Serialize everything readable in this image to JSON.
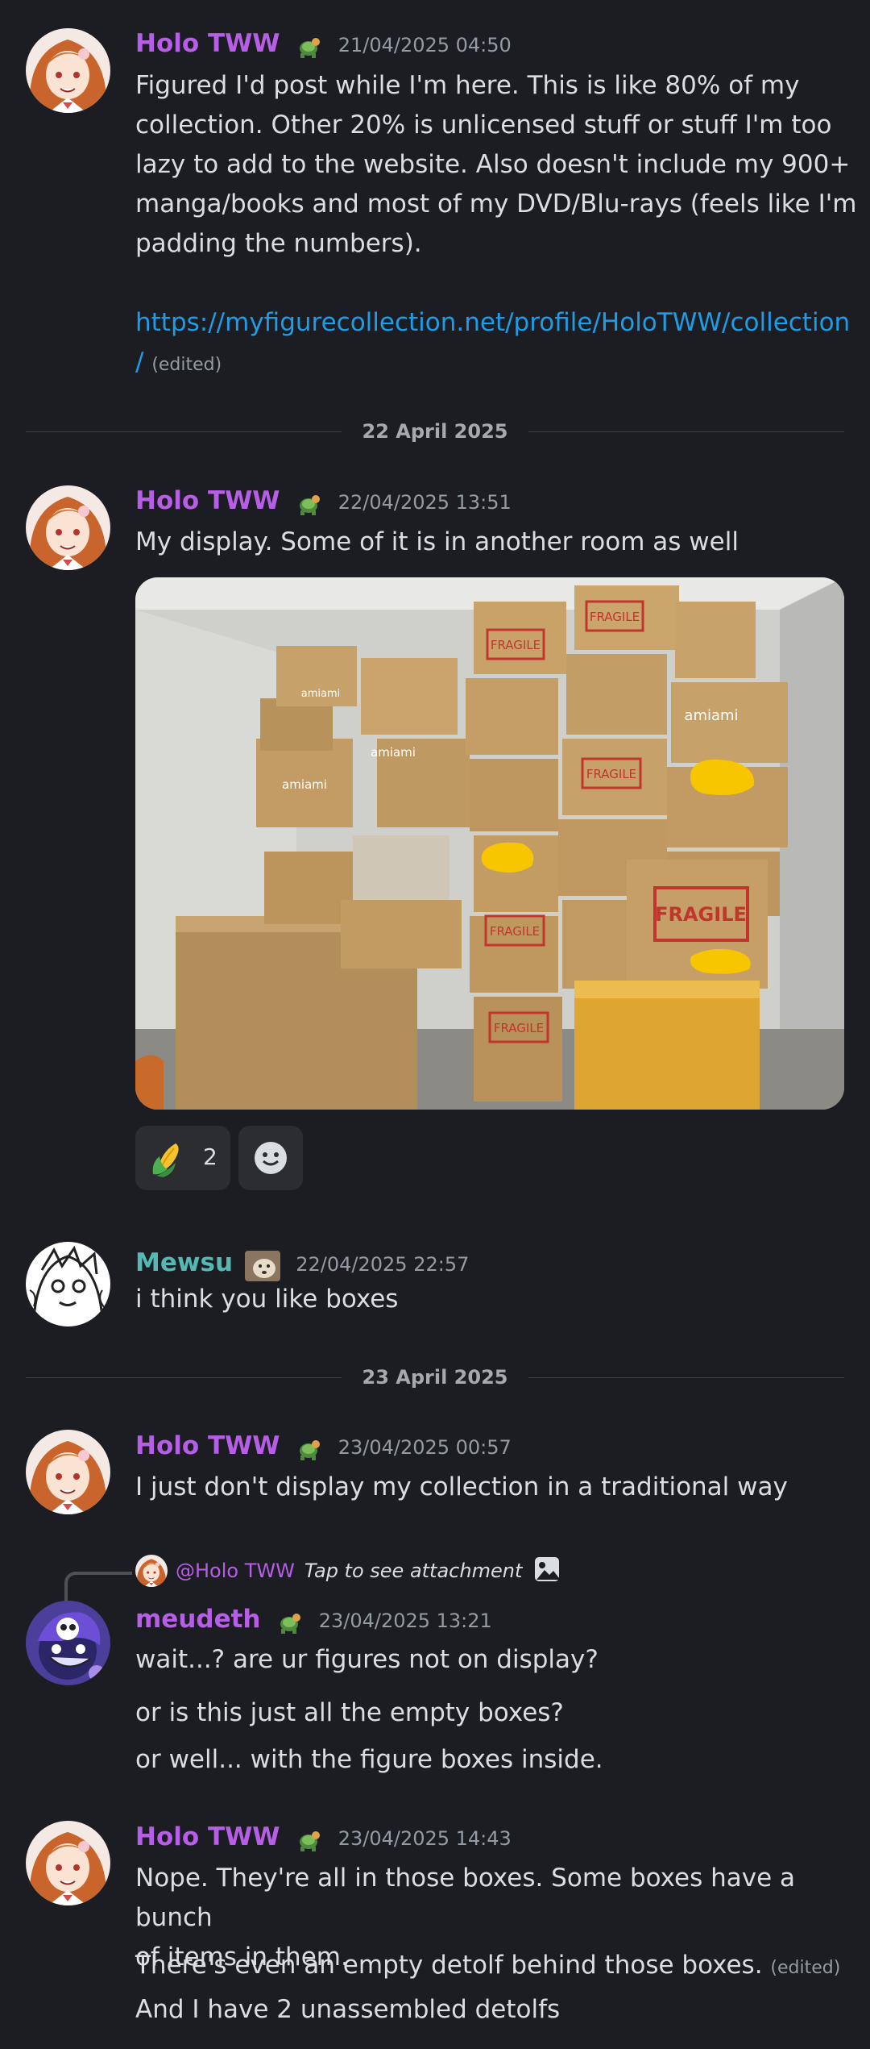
{
  "messages": [
    {
      "author": "Holo TWW",
      "timestamp": "21/04/2025 04:50",
      "text_lines": [
        "Figured I'd post while I'm here. This is like 80% of my",
        "collection. Other 20% is unlicensed stuff or stuff I'm too",
        "lazy to add to the website. Also doesn't include my 900+",
        "manga/books and most of my DVD/Blu-rays (feels like I'm",
        "padding the numbers)."
      ],
      "link_line1": "https://myfigurecollection.net/profile/HoloTWW/collection",
      "link_line2": "/",
      "edited": "(edited)"
    },
    {
      "author": "Holo TWW",
      "timestamp": "22/04/2025 13:51",
      "text": "My display. Some of it is in another room as well",
      "image_labels": [
        "FRAGILE",
        "FRAGILE",
        "FRAGILE",
        "FRAGILE",
        "FRAGILE",
        "FRAGILE",
        "amiami",
        "amiami",
        "amiami",
        "amiami"
      ],
      "reaction_count": "2",
      "reaction_emoji": "corn-emoji"
    },
    {
      "author": "Mewsu",
      "timestamp": "22/04/2025 22:57",
      "text": "i think you like boxes"
    },
    {
      "author": "Holo TWW",
      "timestamp": "23/04/2025 00:57",
      "text": "I just don't display my collection in a traditional way"
    },
    {
      "reply_to": "@Holo TWW",
      "reply_text": "Tap to see attachment",
      "author": "meudeth",
      "timestamp": "23/04/2025 13:21",
      "text": "wait...? are ur figures not on display?",
      "followups": [
        "or is this just all the empty boxes?",
        "or well... with the figure boxes inside."
      ]
    },
    {
      "author": "Holo TWW",
      "timestamp": "23/04/2025 14:43",
      "text_lines": [
        "Nope. They're all in those boxes. Some boxes have a bunch",
        "of items in them."
      ],
      "followup1": "There's even an empty detolf behind those boxes.",
      "followup1_edited": "(edited)",
      "followup2": "And I have 2 unassembled detolfs"
    }
  ],
  "dividers": [
    "22 April 2025",
    "23 April 2025"
  ],
  "colors": {
    "background": "#1c1d22",
    "holo_name": "#b65ee6",
    "mewsu_name": "#56b8b2",
    "link": "#1e9ce6",
    "text": "#dbdee1",
    "muted": "#949ba4"
  }
}
